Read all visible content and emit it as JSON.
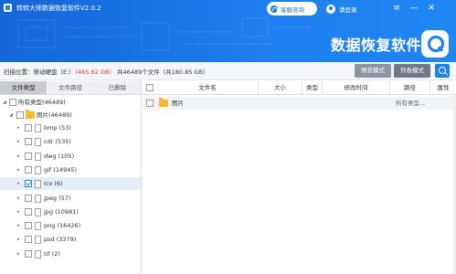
{
  "window": {
    "title": "转转大师数据恢复软件V2.0.2",
    "support_label": "客服咨询",
    "login_label": "请登录",
    "menu_glyph": "≡",
    "minimize_glyph": "—",
    "close_glyph": "✕"
  },
  "brand": {
    "text": "数据恢复软件"
  },
  "scan": {
    "location_label": "扫描位置：移动硬盘（E:）",
    "size_open": "（",
    "size_value": "465.62 GB",
    "size_close": "）",
    "total_text": "共46489个文件（共180.85 GB）",
    "preview_mode": "预览模式",
    "list_mode": "列表模式"
  },
  "tabs": [
    {
      "label": "文件类型",
      "active": true
    },
    {
      "label": "文件路径",
      "active": false
    },
    {
      "label": "已删除",
      "active": false
    }
  ],
  "tree": {
    "root": {
      "label": "所有类型(46489)",
      "expanded": true,
      "checked": false
    },
    "images": {
      "label": "图片(46489)",
      "expanded": true,
      "checked": false
    },
    "items": [
      {
        "label": "bmp (53)",
        "checked": false
      },
      {
        "label": "cdr (535)",
        "checked": false
      },
      {
        "label": "dwg (105)",
        "checked": false
      },
      {
        "label": "gif (14945)",
        "checked": false
      },
      {
        "label": "ico (6)",
        "checked": true,
        "selected": true
      },
      {
        "label": "jpeg (57)",
        "checked": false
      },
      {
        "label": "jpg (10981)",
        "checked": false
      },
      {
        "label": "png (16426)",
        "checked": false
      },
      {
        "label": "psd (3379)",
        "checked": false
      },
      {
        "label": "tif (2)",
        "checked": false
      }
    ]
  },
  "table": {
    "columns": [
      "文件名",
      "大小",
      "类型",
      "修改时间",
      "路径",
      "属性"
    ],
    "rows": [
      {
        "name": "图片",
        "size": "",
        "type": "",
        "modified": "",
        "path": "所有类型...",
        "attr": ""
      }
    ]
  },
  "colors": {
    "accent": "#1e7ff0",
    "highlight": "#e0341c"
  }
}
